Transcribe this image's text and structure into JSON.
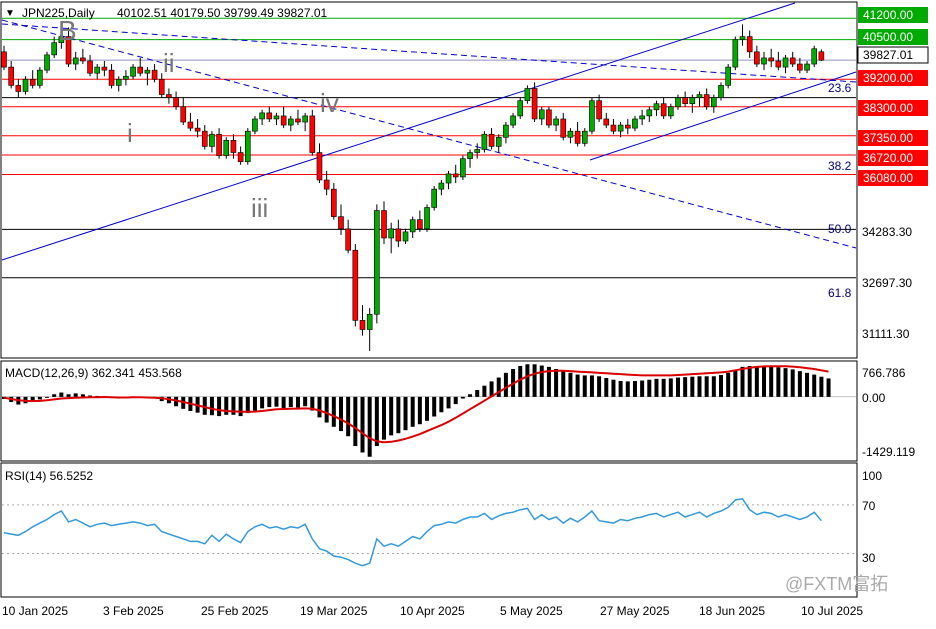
{
  "header": {
    "symbol": "JPN225,Daily",
    "ohlc": "40102.51 40179.50 39799.49 39827.01"
  },
  "price_axis": {
    "ticks": [
      "34283.30",
      "32697.30",
      "31111.30"
    ]
  },
  "levels": [
    {
      "value": "41200.00",
      "color": "#00aa00",
      "box": "#00aa00"
    },
    {
      "value": "40500.00",
      "color": "#00aa00",
      "box": "#00aa00"
    },
    {
      "value": "39200.00",
      "color": "#ff0000",
      "box": "#ff0000"
    },
    {
      "value": "38300.00",
      "color": "#ff0000",
      "box": "#ff0000"
    },
    {
      "value": "37350.00",
      "color": "#ff0000",
      "box": "#ff0000"
    },
    {
      "value": "36720.00",
      "color": "#ff0000",
      "box": "#ff0000"
    },
    {
      "value": "36080.00",
      "color": "#ff0000",
      "box": "#ff0000"
    }
  ],
  "current_price": "39827.01",
  "fib_labels": [
    "23.6",
    "38.2",
    "50.0",
    "61.8"
  ],
  "wave_labels": [
    "B",
    "ii",
    "i",
    "iii",
    "iv"
  ],
  "macd": {
    "label": "MACD(12,26,9) 362.341 453.568",
    "ticks": [
      "766.786",
      "0.00",
      "-1429.119"
    ]
  },
  "rsi": {
    "label": "RSI(14) 56.5252",
    "ticks": [
      "100",
      "70",
      "30"
    ]
  },
  "dates": [
    "10 Jan 2025",
    "3 Feb 2025",
    "25 Feb 2025",
    "19 Mar 2025",
    "10 Apr 2025",
    "5 May 2025",
    "27 May 2025",
    "18 Jun 2025",
    "10 Jul 2025"
  ],
  "watermark": "@FXTM富拓",
  "colors": {
    "up": "#00aa00",
    "down": "#ff0000",
    "trend": "#0000cc",
    "macd_signal": "#dd0000",
    "rsi": "#3399dd"
  },
  "chart_data": {
    "type": "candlestick",
    "title": "JPN225,Daily",
    "x_range": [
      "2025-01-07",
      "2025-07-16"
    ],
    "y_range": [
      30100,
      41700
    ],
    "candles": [
      [
        40100,
        40300,
        39500,
        39600
      ],
      [
        39600,
        39800,
        38900,
        39000
      ],
      [
        39000,
        39200,
        38600,
        38800
      ],
      [
        38800,
        39300,
        38700,
        39200
      ],
      [
        39200,
        39500,
        38900,
        39000
      ],
      [
        39000,
        39600,
        38900,
        39500
      ],
      [
        39500,
        40100,
        39400,
        40000
      ],
      [
        40000,
        40600,
        39900,
        40400
      ],
      [
        40400,
        40800,
        40200,
        40600
      ],
      [
        40600,
        40900,
        39600,
        39700
      ],
      [
        39700,
        40100,
        39500,
        39900
      ],
      [
        39900,
        40200,
        39700,
        39800
      ],
      [
        39800,
        40000,
        39300,
        39400
      ],
      [
        39400,
        39700,
        39200,
        39600
      ],
      [
        39600,
        39800,
        39300,
        39500
      ],
      [
        39500,
        39700,
        38900,
        39000
      ],
      [
        39000,
        39300,
        38800,
        39200
      ],
      [
        39200,
        39500,
        39000,
        39300
      ],
      [
        39300,
        39700,
        39200,
        39600
      ],
      [
        39600,
        39900,
        39300,
        39400
      ],
      [
        39400,
        39600,
        39000,
        39500
      ],
      [
        39500,
        39700,
        39100,
        39200
      ],
      [
        39200,
        39400,
        38600,
        38700
      ],
      [
        38700,
        38900,
        38400,
        38600
      ],
      [
        38600,
        38800,
        38200,
        38300
      ],
      [
        38300,
        38600,
        37700,
        37800
      ],
      [
        37800,
        38100,
        37500,
        37600
      ],
      [
        37600,
        37900,
        37300,
        37500
      ],
      [
        37500,
        37700,
        36900,
        37000
      ],
      [
        37000,
        37500,
        36800,
        37400
      ],
      [
        37400,
        37600,
        36600,
        36700
      ],
      [
        36700,
        37300,
        36600,
        37200
      ],
      [
        37200,
        37400,
        36600,
        36800
      ],
      [
        36800,
        37000,
        36400,
        36500
      ],
      [
        36500,
        37600,
        36400,
        37500
      ],
      [
        37500,
        38000,
        37400,
        37900
      ],
      [
        37900,
        38200,
        37700,
        38100
      ],
      [
        38100,
        38300,
        37800,
        37900
      ],
      [
        37900,
        38100,
        37700,
        38000
      ],
      [
        38000,
        38300,
        37600,
        37700
      ],
      [
        37700,
        38000,
        37500,
        37900
      ],
      [
        37900,
        38200,
        37700,
        37800
      ],
      [
        37800,
        38100,
        37500,
        38000
      ],
      [
        38000,
        38200,
        36700,
        36800
      ],
      [
        36800,
        37100,
        35800,
        35900
      ],
      [
        35900,
        36200,
        35400,
        35600
      ],
      [
        35600,
        35800,
        34600,
        34700
      ],
      [
        34700,
        35100,
        34100,
        34300
      ],
      [
        34300,
        34600,
        33500,
        33600
      ],
      [
        33600,
        33800,
        31100,
        31300
      ],
      [
        31300,
        31800,
        30800,
        31000
      ],
      [
        31000,
        31700,
        30300,
        31500
      ],
      [
        31500,
        35100,
        31200,
        34900
      ],
      [
        34900,
        35200,
        33800,
        34000
      ],
      [
        34000,
        34500,
        33500,
        34300
      ],
      [
        34300,
        34600,
        33700,
        33900
      ],
      [
        33900,
        34300,
        33800,
        34200
      ],
      [
        34200,
        34700,
        34000,
        34600
      ],
      [
        34600,
        34900,
        34200,
        34300
      ],
      [
        34300,
        35100,
        34200,
        35000
      ],
      [
        35000,
        35700,
        34900,
        35600
      ],
      [
        35600,
        35900,
        35400,
        35800
      ],
      [
        35800,
        36200,
        35600,
        36100
      ],
      [
        36100,
        36400,
        35800,
        36000
      ],
      [
        36000,
        36700,
        35900,
        36600
      ],
      [
        36600,
        36900,
        36300,
        36800
      ],
      [
        36800,
        37100,
        36600,
        36900
      ],
      [
        36900,
        37500,
        36800,
        37400
      ],
      [
        37400,
        37600,
        36900,
        37000
      ],
      [
        37000,
        37400,
        36800,
        37300
      ],
      [
        37300,
        37800,
        37100,
        37700
      ],
      [
        37700,
        38100,
        37600,
        38000
      ],
      [
        38000,
        38600,
        37900,
        38500
      ],
      [
        38500,
        39000,
        38400,
        38900
      ],
      [
        38900,
        39100,
        37800,
        37900
      ],
      [
        37900,
        38300,
        37700,
        38200
      ],
      [
        38200,
        38300,
        37600,
        37700
      ],
      [
        37700,
        38000,
        37500,
        37900
      ],
      [
        37900,
        38100,
        37200,
        37300
      ],
      [
        37300,
        37600,
        37100,
        37500
      ],
      [
        37500,
        37800,
        37000,
        37100
      ],
      [
        37100,
        37600,
        37000,
        37500
      ],
      [
        37500,
        38600,
        37400,
        38500
      ],
      [
        38500,
        38700,
        37800,
        37900
      ],
      [
        37900,
        38100,
        37600,
        37700
      ],
      [
        37700,
        37900,
        37400,
        37500
      ],
      [
        37500,
        37800,
        37300,
        37700
      ],
      [
        37700,
        37900,
        37400,
        37600
      ],
      [
        37600,
        38000,
        37500,
        37900
      ],
      [
        37900,
        38200,
        37700,
        38000
      ],
      [
        38000,
        38300,
        37800,
        38200
      ],
      [
        38200,
        38500,
        38000,
        38400
      ],
      [
        38400,
        38600,
        37900,
        38000
      ],
      [
        38000,
        38400,
        37900,
        38300
      ],
      [
        38300,
        38700,
        38200,
        38600
      ],
      [
        38600,
        38800,
        38300,
        38400
      ],
      [
        38400,
        38700,
        38100,
        38600
      ],
      [
        38600,
        38800,
        38300,
        38700
      ],
      [
        38700,
        38900,
        38200,
        38300
      ],
      [
        38300,
        38700,
        38100,
        38600
      ],
      [
        38600,
        39100,
        38500,
        39000
      ],
      [
        39000,
        39700,
        38900,
        39600
      ],
      [
        39600,
        40600,
        39500,
        40500
      ],
      [
        40500,
        41000,
        40300,
        40600
      ],
      [
        40600,
        40800,
        39900,
        40100
      ],
      [
        40100,
        40300,
        39600,
        39700
      ],
      [
        39700,
        40100,
        39500,
        39900
      ],
      [
        39900,
        40200,
        39600,
        39800
      ],
      [
        39800,
        40100,
        39500,
        39600
      ],
      [
        39600,
        40000,
        39400,
        39900
      ],
      [
        39900,
        40100,
        39600,
        39700
      ],
      [
        39700,
        39900,
        39400,
        39500
      ],
      [
        39500,
        39800,
        39400,
        39700
      ],
      [
        39700,
        40300,
        39600,
        40200
      ],
      [
        40102.51,
        40179.5,
        39799.49,
        39827.01
      ]
    ],
    "macd": {
      "name": "MACD(12,26,9)",
      "histogram": [
        -50,
        -120,
        -180,
        -150,
        -100,
        -60,
        0,
        60,
        100,
        60,
        80,
        60,
        30,
        20,
        10,
        -30,
        -40,
        -20,
        10,
        -10,
        -30,
        -40,
        -100,
        -150,
        -220,
        -280,
        -330,
        -370,
        -420,
        -430,
        -450,
        -420,
        -420,
        -450,
        -380,
        -320,
        -270,
        -240,
        -230,
        -260,
        -240,
        -250,
        -220,
        -320,
        -480,
        -600,
        -700,
        -800,
        -920,
        -1150,
        -1300,
        -1400,
        -1150,
        -1000,
        -900,
        -850,
        -780,
        -700,
        -640,
        -560,
        -460,
        -360,
        -270,
        -170,
        -40,
        60,
        160,
        260,
        360,
        450,
        560,
        650,
        720,
        760,
        760,
        730,
        700,
        650,
        600,
        560,
        520,
        500,
        500,
        480,
        440,
        400,
        370,
        360,
        370,
        380,
        400,
        420,
        420,
        430,
        450,
        460,
        470,
        480,
        480,
        480,
        510,
        560,
        620,
        700,
        720,
        720,
        720,
        700,
        690,
        670,
        640,
        600,
        560,
        520,
        470,
        430
      ],
      "signal": [
        -20,
        -50,
        -80,
        -95,
        -100,
        -95,
        -80,
        -60,
        -40,
        -30,
        -20,
        -15,
        -10,
        -8,
        -5,
        -10,
        -15,
        -16,
        -12,
        -12,
        -15,
        -20,
        -35,
        -55,
        -85,
        -120,
        -160,
        -200,
        -240,
        -280,
        -310,
        -330,
        -340,
        -350,
        -350,
        -345,
        -330,
        -310,
        -290,
        -285,
        -280,
        -275,
        -270,
        -280,
        -320,
        -380,
        -450,
        -530,
        -620,
        -730,
        -850,
        -970,
        -1040,
        -1060,
        -1050,
        -1020,
        -980,
        -930,
        -870,
        -800,
        -730,
        -660,
        -580,
        -490,
        -390,
        -290,
        -190,
        -90,
        10,
        110,
        210,
        310,
        400,
        480,
        540,
        580,
        600,
        610,
        610,
        600,
        590,
        580,
        570,
        560,
        550,
        540,
        530,
        520,
        510,
        500,
        500,
        500,
        500,
        500,
        510,
        520,
        530,
        540,
        550,
        560,
        570,
        590,
        620,
        650,
        680,
        700,
        710,
        715,
        715,
        712,
        705,
        690,
        670,
        650,
        620,
        590
      ]
    },
    "rsi": {
      "name": "RSI(14)",
      "values": [
        47,
        46,
        45,
        48,
        52,
        55,
        58,
        62,
        65,
        56,
        58,
        55,
        52,
        54,
        55,
        53,
        54,
        55,
        56,
        55,
        53,
        54,
        48,
        46,
        44,
        42,
        40,
        40,
        38,
        45,
        40,
        46,
        42,
        39,
        48,
        52,
        54,
        51,
        52,
        50,
        52,
        51,
        54,
        42,
        34,
        32,
        28,
        27,
        25,
        22,
        20,
        22,
        42,
        36,
        38,
        36,
        40,
        44,
        42,
        48,
        53,
        54,
        56,
        55,
        58,
        60,
        60,
        63,
        58,
        61,
        63,
        64,
        66,
        67,
        58,
        62,
        58,
        60,
        55,
        59,
        56,
        60,
        65,
        57,
        56,
        55,
        58,
        57,
        59,
        60,
        62,
        63,
        60,
        62,
        64,
        60,
        62,
        64,
        60,
        63,
        65,
        68,
        74,
        75,
        66,
        62,
        64,
        63,
        60,
        62,
        60,
        58,
        60,
        64,
        57
      ]
    }
  }
}
